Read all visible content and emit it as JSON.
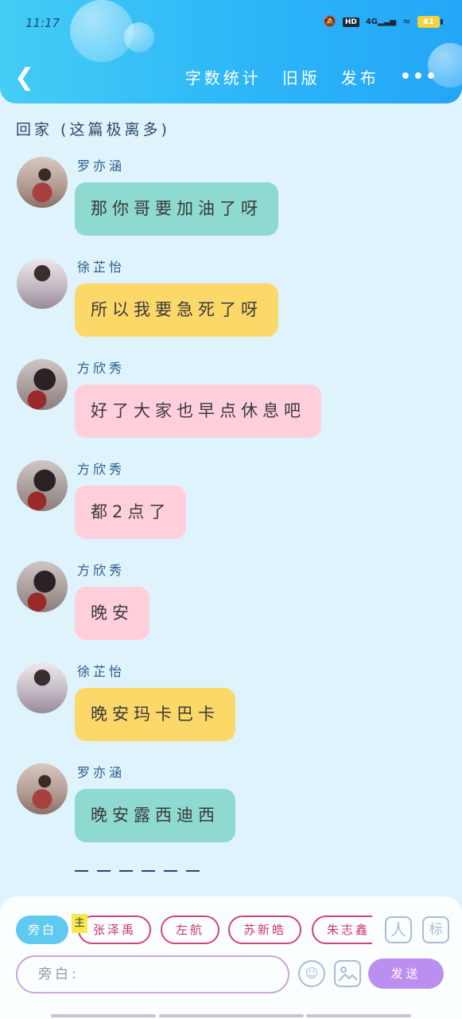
{
  "status_bar": {
    "time": "11:17",
    "network": "4G",
    "battery": "81"
  },
  "header": {
    "actions": [
      "字数统计",
      "旧版",
      "发布"
    ],
    "more": "•••"
  },
  "topic": "回家 (这篇极离多)",
  "messages": [
    {
      "sender": "罗亦涵",
      "text": "那你哥要加油了呀",
      "color": "#8ed9d0"
    },
    {
      "sender": "徐芷怡",
      "text": "所以我要急死了呀",
      "color": "#fcd869"
    },
    {
      "sender": "方欣秀",
      "text": "好了大家也早点休息吧",
      "color": "#ffd0dc"
    },
    {
      "sender": "方欣秀",
      "text": "都2点了",
      "color": "#ffd0dc"
    },
    {
      "sender": "方欣秀",
      "text": "晚安",
      "color": "#ffd0dc"
    },
    {
      "sender": "徐芷怡",
      "text": "晚安玛卡巴卡",
      "color": "#fcd869"
    },
    {
      "sender": "罗亦涵",
      "text": "晚安露西迪西",
      "color": "#8ed9d0"
    }
  ],
  "composer": {
    "narration_chip": "旁白",
    "host_tag": "主",
    "roles": [
      "张泽禹",
      "左航",
      "苏新皓",
      "朱志鑫"
    ],
    "role_icon": "人",
    "mark_icon": "标",
    "placeholder": "旁白:",
    "send_label": "发送"
  },
  "colors": {
    "accent": "#2db5f8",
    "send": "#ba8ff0",
    "role_border": "#d1417f"
  }
}
